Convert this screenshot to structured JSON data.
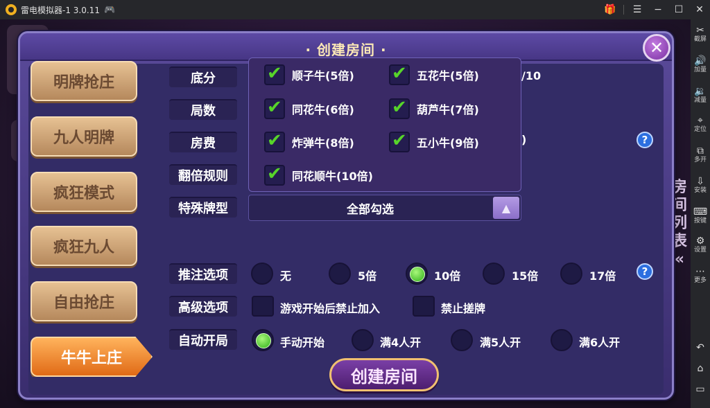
{
  "window": {
    "title": "雷电模拟器-1 3.0.11",
    "controls": {
      "gift": "🎁",
      "menu": "☰",
      "minimize": "−",
      "maximize": "☐",
      "close": "✕"
    }
  },
  "sidebar": [
    {
      "icon": "✂",
      "label": "截屏"
    },
    {
      "icon": "🔊",
      "label": "加量"
    },
    {
      "icon": "🔉",
      "label": "减量"
    },
    {
      "icon": "⌖",
      "label": "定位"
    },
    {
      "icon": "⧉",
      "label": "多开"
    },
    {
      "icon": "⇩",
      "label": "安装"
    },
    {
      "icon": "⌨",
      "label": "按键"
    },
    {
      "icon": "⚙",
      "label": "设置"
    },
    {
      "icon": "⋯",
      "label": "更多"
    }
  ],
  "sidebar_nav": {
    "back": "↶",
    "home": "⌂",
    "recent": "▭"
  },
  "background": {
    "side_text": [
      "房",
      "间",
      "列",
      "表",
      "«"
    ]
  },
  "dialog": {
    "title": "· 创建房间 ·",
    "close": "✕",
    "tabs": [
      "明牌抢庄",
      "九人明牌",
      "疯狂模式",
      "疯狂九人",
      "自由抢庄",
      "牛牛上庄"
    ],
    "active_tab": 5,
    "labels": [
      "底分",
      "局数",
      "房费",
      "翻倍规则",
      "特殊牌型",
      "推注选项",
      "高级选项",
      "自动开局"
    ],
    "partial_texts": {
      "row1": "/10",
      "row3": ")"
    },
    "special_dropdown": {
      "value": "全部勾选",
      "arrow": "▲"
    },
    "special_options": [
      {
        "label": "顺子牛(5倍)",
        "checked": true
      },
      {
        "label": "五花牛(5倍)",
        "checked": true
      },
      {
        "label": "同花牛(6倍)",
        "checked": true
      },
      {
        "label": "葫芦牛(7倍)",
        "checked": true
      },
      {
        "label": "炸弹牛(8倍)",
        "checked": true
      },
      {
        "label": "五小牛(9倍)",
        "checked": true
      },
      {
        "label": "同花顺牛(10倍)",
        "checked": true
      }
    ],
    "check_mark": "✔",
    "push_options": [
      {
        "label": "无",
        "selected": false
      },
      {
        "label": "5倍",
        "selected": false
      },
      {
        "label": "10倍",
        "selected": true
      },
      {
        "label": "15倍",
        "selected": false
      },
      {
        "label": "17倍",
        "selected": false
      }
    ],
    "advanced_options": [
      {
        "label": "游戏开始后禁止加入",
        "checked": false
      },
      {
        "label": "禁止搓牌",
        "checked": false
      }
    ],
    "auto_start_options": [
      {
        "label": "手动开始",
        "selected": true
      },
      {
        "label": "满4人开",
        "selected": false
      },
      {
        "label": "满5人开",
        "selected": false
      },
      {
        "label": "满6人开",
        "selected": false
      }
    ],
    "help": "?",
    "create_button": "创建房间"
  },
  "colors": {
    "accent": "#e06a16",
    "check": "#57d42a",
    "panel": "#332c66"
  }
}
